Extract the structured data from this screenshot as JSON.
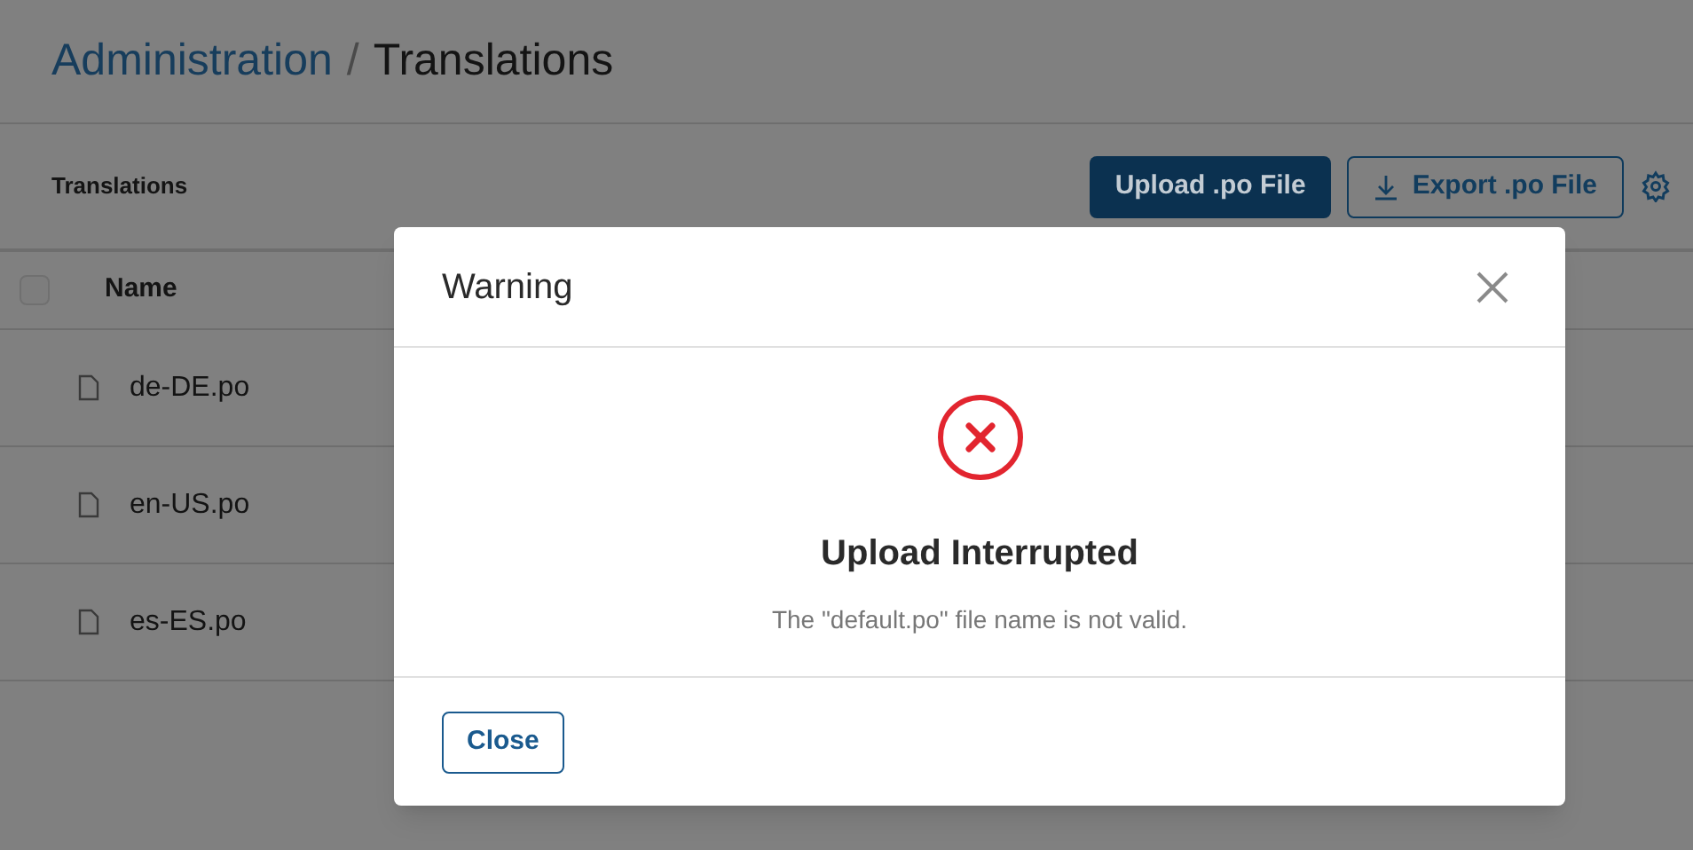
{
  "breadcrumb": {
    "parent": "Administration",
    "separator": "/",
    "current": "Translations"
  },
  "toolbar": {
    "title": "Translations",
    "buttons": [
      {
        "label": "Upload .po File",
        "kind": "primary"
      },
      {
        "label": "Export .po File",
        "kind": "export"
      }
    ]
  },
  "table": {
    "select_all": {
      "checked": false
    },
    "columns": [
      "Name"
    ],
    "rows": [
      {
        "name": "de-DE.po"
      },
      {
        "name": "en-US.po"
      },
      {
        "name": "es-ES.po"
      }
    ]
  },
  "dialog": {
    "title": "Warning",
    "heading": "Upload Interrupted",
    "message": "The \"default.po\" file name is not valid.",
    "button": "Close"
  }
}
